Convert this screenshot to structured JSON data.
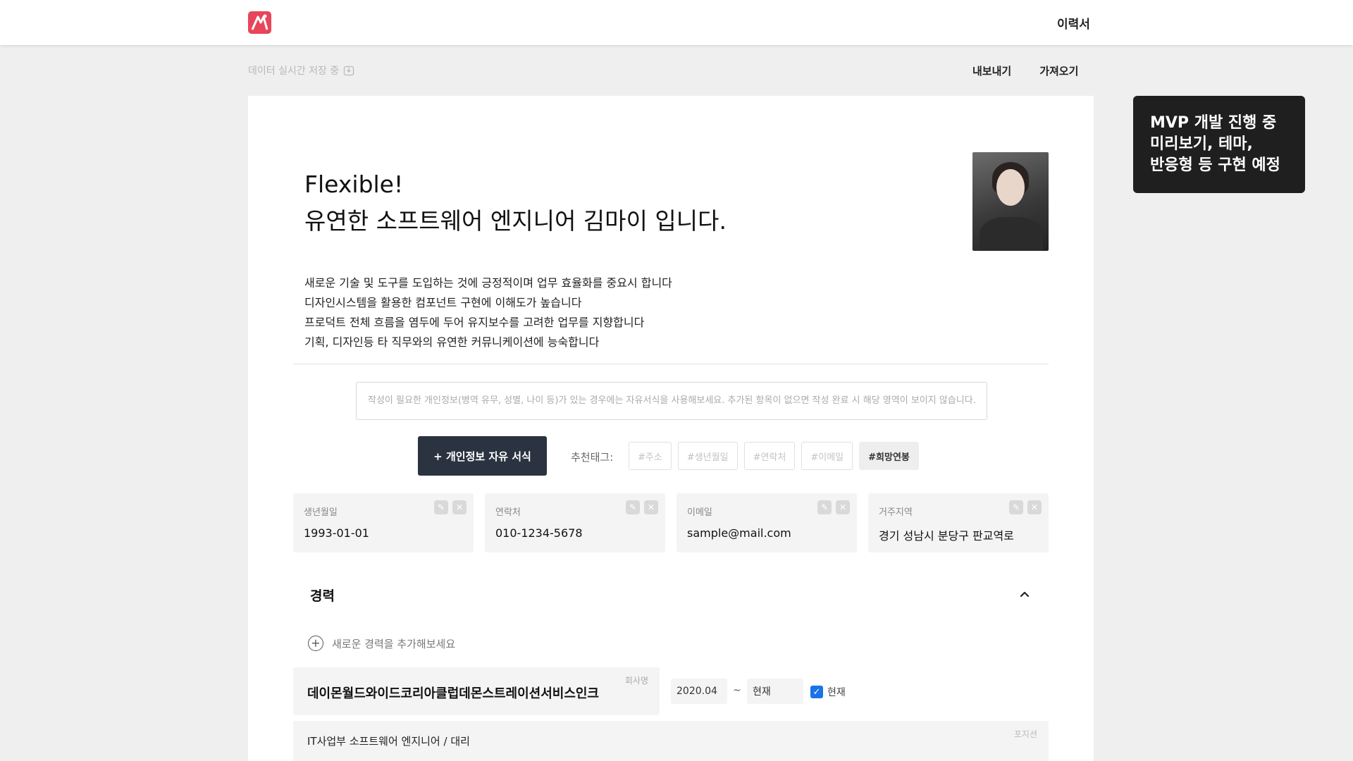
{
  "header": {
    "nav_title": "이력서"
  },
  "toolbar": {
    "save_status": "데이터 실시간 저장 중",
    "export_label": "내보내기",
    "import_label": "가져오기"
  },
  "profile": {
    "headline_line1": "Flexible!",
    "headline_line2": "유연한 소프트웨어 엔지니어 김마이 입니다.",
    "intro": [
      "새로운 기술 및 도구를 도입하는 것에 긍정적이며 업무 효율화를 중요시 합니다",
      "디자인시스템을 활용한 컴포넌트 구현에 이해도가 높습니다",
      "프로덕트 전체 흐름을 염두에 두어 유지보수를 고려한 업무를 지향합니다",
      "기획, 디자인등 타 직무와의 유연한 커뮤니케이션에 능숙합니다"
    ]
  },
  "personal_info": {
    "hint": "작성이 필요한 개인정보(병역 유무, 성별, 나이 등)가 있는 경우에는 자유서식을 사용해보세요. 추가된 항목이 없으면 작성 완료 시 해당 영역이 보이지 않습니다.",
    "add_button": "+ 개인정보 자유 서식",
    "tags_label": "추천태그:",
    "tags": [
      "#주소",
      "#생년월일",
      "#연락처",
      "#이메일",
      "#희망연봉"
    ],
    "cards": [
      {
        "label": "생년월일",
        "value": "1993-01-01"
      },
      {
        "label": "연락처",
        "value": "010-1234-5678"
      },
      {
        "label": "이메일",
        "value": "sample@mail.com"
      },
      {
        "label": "거주지역",
        "value": "경기 성남시 분당구 판교역로"
      }
    ]
  },
  "career": {
    "title": "경력",
    "add_label": "새로운 경력을 추가해보세요",
    "company_label": "회사명",
    "company_name": "데이몬월드와이드코리아클럽데몬스트레이션서비스인크",
    "start_date": "2020.04",
    "tilde": "~",
    "end_date": "현재",
    "current_label": "현재",
    "current_checked": true,
    "position_label": "포지션",
    "position_value": "IT사업부 소프트웨어 엔지니어 / 대리"
  },
  "notice": {
    "lines": [
      "MVP 개발 진행 중",
      "미리보기, 테마,",
      "반응형 등 구현 예정"
    ]
  },
  "colors": {
    "brand": "#e8455a",
    "primary_button": "#2b3340",
    "checkbox": "#1a73e8",
    "notice_bg": "#1f1f1f"
  }
}
